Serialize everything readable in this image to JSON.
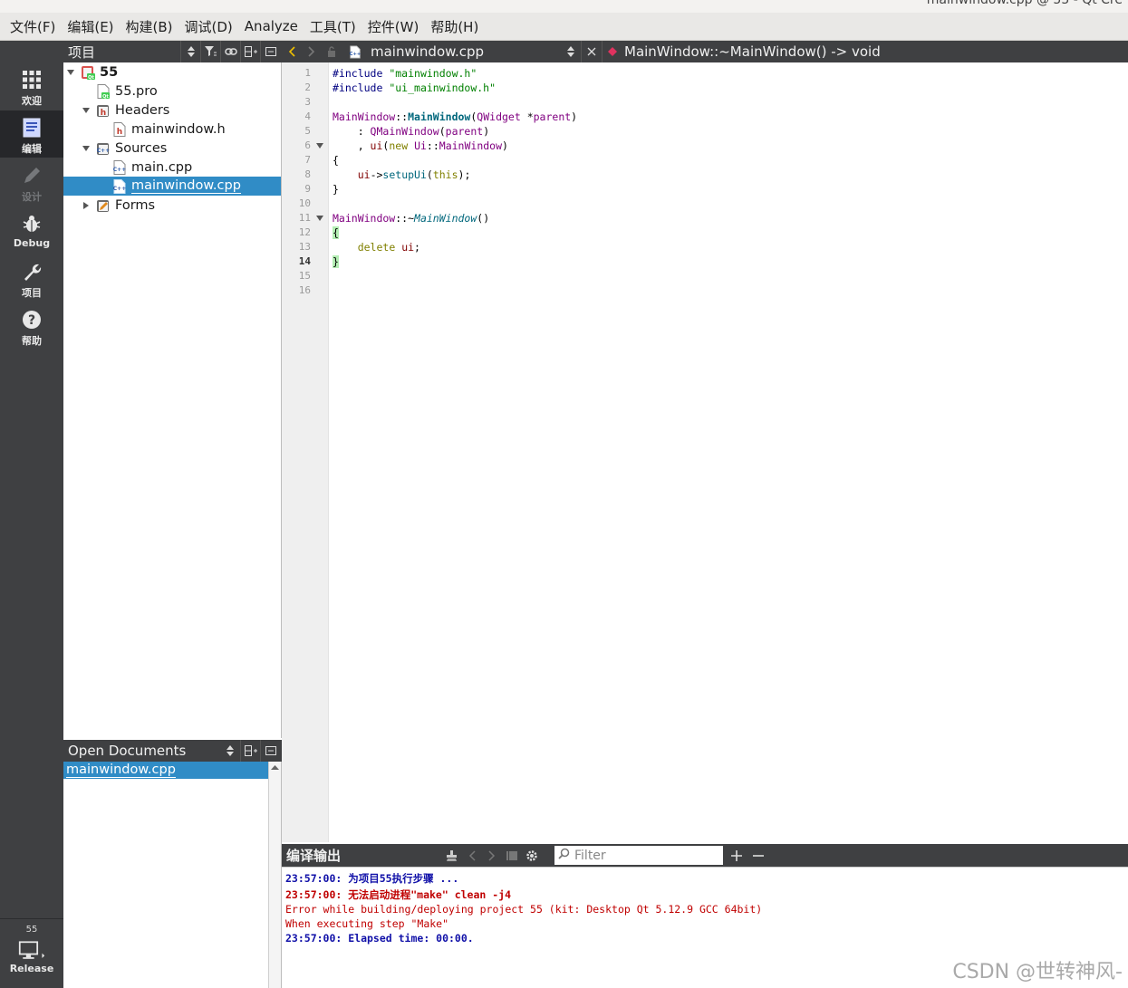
{
  "window": {
    "title_fragment": "mainwindow.cpp @ 55 - Qt Cre"
  },
  "menu": [
    "文件(F)",
    "编辑(E)",
    "构建(B)",
    "调试(D)",
    "Analyze",
    "工具(T)",
    "控件(W)",
    "帮助(H)"
  ],
  "modes": [
    {
      "label": "欢迎",
      "icon": "grid-icon",
      "active": false,
      "enabled": true
    },
    {
      "label": "编辑",
      "icon": "document-icon",
      "active": true,
      "enabled": true
    },
    {
      "label": "设计",
      "icon": "pencil-icon",
      "active": false,
      "enabled": false
    },
    {
      "label": "Debug",
      "icon": "bug-icon",
      "active": false,
      "enabled": true
    },
    {
      "label": "项目",
      "icon": "wrench-icon",
      "active": false,
      "enabled": true
    },
    {
      "label": "帮助",
      "icon": "help-icon",
      "active": false,
      "enabled": true
    }
  ],
  "kit": {
    "project": "55",
    "build": "Release"
  },
  "project_pane": {
    "title": "项目",
    "tree": [
      {
        "label": "55",
        "kind": "project",
        "expanded": true
      },
      {
        "label": "55.pro",
        "kind": "pro-file"
      },
      {
        "label": "Headers",
        "kind": "folder",
        "expanded": true
      },
      {
        "label": "mainwindow.h",
        "kind": "header-file"
      },
      {
        "label": "Sources",
        "kind": "folder",
        "expanded": true
      },
      {
        "label": "main.cpp",
        "kind": "cpp-file"
      },
      {
        "label": "mainwindow.cpp",
        "kind": "cpp-file",
        "selected": true
      },
      {
        "label": "Forms",
        "kind": "folder",
        "expanded": false
      }
    ]
  },
  "open_documents": {
    "title": "Open Documents",
    "items": [
      "mainwindow.cpp"
    ]
  },
  "editor": {
    "file": "mainwindow.cpp",
    "symbol": "MainWindow::~MainWindow() -> void",
    "current_line": 14,
    "line_numbers": [
      "1",
      "2",
      "3",
      "4",
      "5",
      "6",
      "7",
      "8",
      "9",
      "10",
      "11",
      "12",
      "13",
      "14",
      "15",
      "16"
    ],
    "lines": [
      "#include \"mainwindow.h\"",
      "#include \"ui_mainwindow.h\"",
      "",
      "MainWindow::MainWindow(QWidget *parent)",
      "    : QMainWindow(parent)",
      "    , ui(new Ui::MainWindow)",
      "{",
      "    ui->setupUi(this);",
      "}",
      "",
      "MainWindow::~MainWindow()",
      "{",
      "    delete ui;",
      "}",
      "",
      ""
    ]
  },
  "output": {
    "title": "编译输出",
    "filter_placeholder": "Filter",
    "lines": [
      {
        "text": "23:57:00: 为项目55执行步骤 ...",
        "style": "blue"
      },
      {
        "text": "23:57:00: 无法启动进程\"make\" clean -j4",
        "style": "redb"
      },
      {
        "text": "Error while building/deploying project 55 (kit: Desktop Qt 5.12.9 GCC 64bit)",
        "style": "red"
      },
      {
        "text": "When executing step \"Make\"",
        "style": "red"
      },
      {
        "text": "23:57:00: Elapsed time: 00:00.",
        "style": "blue"
      }
    ]
  },
  "watermark": "CSDN @世转神风-",
  "colors": {
    "selection": "#308cc6",
    "pane_header": "#3f4042",
    "brace_match": "#b4eeb4"
  }
}
